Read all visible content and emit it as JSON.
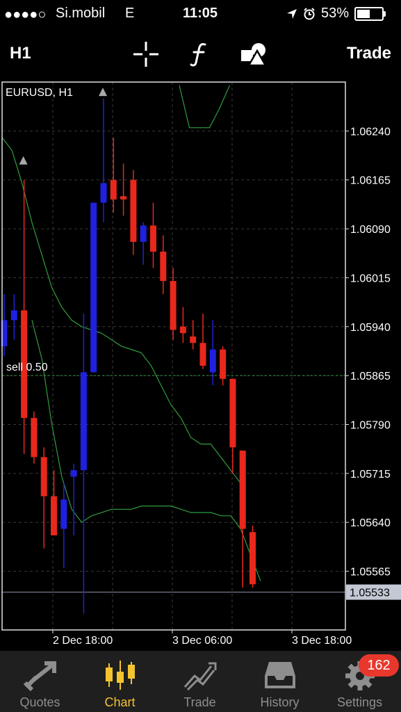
{
  "status_bar": {
    "signal": "●●●●○",
    "carrier": "Si.mobil",
    "network": "E",
    "time": "11:05",
    "battery": "53%",
    "battery_level": 0.53
  },
  "toolbar": {
    "timeframe": "H1",
    "trade_label": "Trade",
    "icons": [
      "crosshair-icon",
      "function-icon",
      "objects-icon"
    ]
  },
  "chart": {
    "symbol_label": "EURUSD, H1",
    "order_label": "sell 0.50",
    "current_price": "1.05533",
    "price_labels": [
      "1.06240",
      "1.06165",
      "1.06090",
      "1.06015",
      "1.05940",
      "1.05865",
      "1.05790",
      "1.05715",
      "1.05640",
      "1.05565"
    ],
    "time_labels": [
      "2 Dec 18:00",
      "3 Dec 06:00",
      "3 Dec 18:00"
    ]
  },
  "chart_data": {
    "type": "candlestick",
    "ylim": [
      1.05475,
      1.06315
    ],
    "bull_color": "#2020e0",
    "bear_color": "#e8281c",
    "current_price": 1.05533,
    "order_price": 1.05865,
    "candles": [
      {
        "o": 1.0591,
        "h": 1.0599,
        "l": 1.05895,
        "c": 1.0595
      },
      {
        "o": 1.0595,
        "h": 1.0599,
        "l": 1.0592,
        "c": 1.05965
      },
      {
        "o": 1.05965,
        "h": 1.06165,
        "l": 1.05745,
        "c": 1.058
      },
      {
        "o": 1.058,
        "h": 1.0581,
        "l": 1.0573,
        "c": 1.0574
      },
      {
        "o": 1.0574,
        "h": 1.05755,
        "l": 1.056,
        "c": 1.0568
      },
      {
        "o": 1.0568,
        "h": 1.0572,
        "l": 1.0564,
        "c": 1.0562
      },
      {
        "o": 1.0563,
        "h": 1.057,
        "l": 1.0557,
        "c": 1.05675
      },
      {
        "o": 1.0571,
        "h": 1.0573,
        "l": 1.0562,
        "c": 1.0572
      },
      {
        "o": 1.0572,
        "h": 1.0596,
        "l": 1.055,
        "c": 1.0587
      },
      {
        "o": 1.0587,
        "h": 1.0612,
        "l": 1.0587,
        "c": 1.0613
      },
      {
        "o": 1.0613,
        "h": 1.0629,
        "l": 1.061,
        "c": 1.0616
      },
      {
        "o": 1.06165,
        "h": 1.0623,
        "l": 1.06115,
        "c": 1.06135
      },
      {
        "o": 1.0614,
        "h": 1.0619,
        "l": 1.0611,
        "c": 1.06135
      },
      {
        "o": 1.06165,
        "h": 1.0618,
        "l": 1.0605,
        "c": 1.0607
      },
      {
        "o": 1.0607,
        "h": 1.061,
        "l": 1.06035,
        "c": 1.06095
      },
      {
        "o": 1.06095,
        "h": 1.0613,
        "l": 1.0603,
        "c": 1.06055
      },
      {
        "o": 1.06055,
        "h": 1.0608,
        "l": 1.0599,
        "c": 1.0601
      },
      {
        "o": 1.0601,
        "h": 1.0603,
        "l": 1.0592,
        "c": 1.05935
      },
      {
        "o": 1.0594,
        "h": 1.0597,
        "l": 1.05915,
        "c": 1.0593
      },
      {
        "o": 1.05925,
        "h": 1.0595,
        "l": 1.05905,
        "c": 1.05915
      },
      {
        "o": 1.05915,
        "h": 1.0596,
        "l": 1.05875,
        "c": 1.0588
      },
      {
        "o": 1.0587,
        "h": 1.0595,
        "l": 1.0585,
        "c": 1.05905
      },
      {
        "o": 1.05905,
        "h": 1.0591,
        "l": 1.0585,
        "c": 1.0586
      },
      {
        "o": 1.0586,
        "h": 1.0586,
        "l": 1.05715,
        "c": 1.05755
      },
      {
        "o": 1.0575,
        "h": 1.0575,
        "l": 1.0554,
        "c": 1.0563
      },
      {
        "o": 1.05625,
        "h": 1.05635,
        "l": 1.0554,
        "c": 1.05545
      }
    ],
    "indicator_upper": [
      1.0623,
      1.0621,
      1.0616,
      1.061,
      1.0605,
      1.06,
      1.0597,
      1.0595,
      1.0594,
      1.05935,
      1.0593,
      1.0592,
      1.0591,
      1.05905,
      1.059,
      1.0588,
      1.0585,
      1.0582,
      1.058,
      1.0577,
      1.0576,
      1.0576,
      1.0574,
      1.0572,
      1.057
    ],
    "indicator_lower": [
      1.0595,
      1.0589,
      1.0579,
      1.0571,
      1.0566,
      1.0564,
      1.0565,
      1.05655,
      1.0566,
      1.0566,
      1.0566,
      1.05665,
      1.05665,
      1.05665,
      1.05665,
      1.0566,
      1.05655,
      1.05655,
      1.05655,
      1.0565,
      1.0565,
      1.0563,
      1.0559,
      1.0555
    ],
    "indicator_top": [
      1.0631,
      1.06245,
      1.06245,
      1.06245,
      1.06275,
      1.0631
    ],
    "arrows": [
      1.06195,
      1.063
    ]
  },
  "tabs": [
    {
      "label": "Quotes",
      "icon": "quotes-icon"
    },
    {
      "label": "Chart",
      "icon": "chart-icon"
    },
    {
      "label": "Trade",
      "icon": "trade-icon"
    },
    {
      "label": "History",
      "icon": "history-icon"
    },
    {
      "label": "Settings",
      "icon": "settings-icon"
    }
  ],
  "settings_badge": "162",
  "colors": {
    "accent": "#f4c430",
    "badge": "#e8372c",
    "indicator": "#2f9e3f"
  }
}
